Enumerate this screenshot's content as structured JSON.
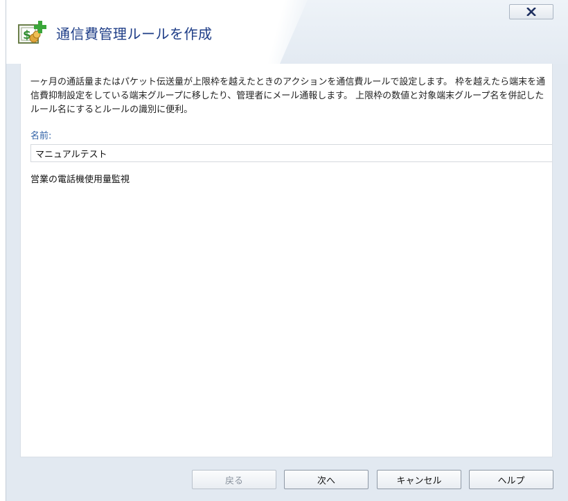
{
  "window": {
    "title": "通信費管理ルールを作成",
    "close_icon": "close-icon"
  },
  "content": {
    "description": "一ヶ月の通話量またはパケット伝送量が上限枠を越えたときのアクションを通信費ルールで設定します。 枠を越えたら端末を通信費抑制設定をしている端末グループに移したり、管理者にメール通報します。 上限枠の数値と対象端末グループ名を併記したルール名にするとルールの識別に便利。",
    "name_label": "名前:",
    "name_value": "マニュアルテスト",
    "description_value": "営業の電話機使用量監視"
  },
  "footer": {
    "back_label": "戻る",
    "next_label": "次へ",
    "cancel_label": "キャンセル",
    "help_label": "ヘルプ"
  },
  "colors": {
    "title_text": "#1e3d87",
    "label_text": "#2d5fa5",
    "dialog_bg": "#e2e9f1"
  }
}
